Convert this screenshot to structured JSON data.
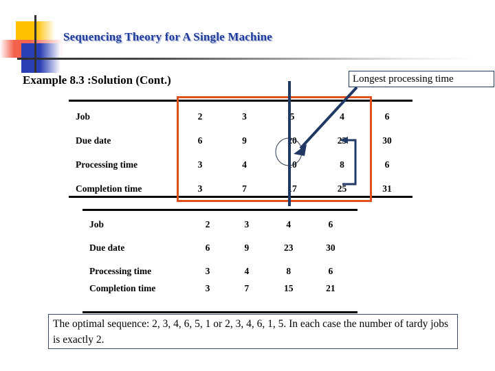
{
  "slide": {
    "title": "Sequencing Theory for A Single Machine",
    "subtitle": "Example 8.3 :Solution (Cont.)"
  },
  "callout": {
    "text": "Longest processing time"
  },
  "table1": {
    "rows": [
      {
        "label": "Job",
        "values": [
          "2",
          "3",
          "5",
          "4",
          "6"
        ]
      },
      {
        "label": "Due date",
        "values": [
          "6",
          "9",
          "20",
          "23",
          "30"
        ]
      },
      {
        "label": "Processing time",
        "values": [
          "3",
          "4",
          "10",
          "8",
          "6"
        ]
      },
      {
        "label": "Completion time",
        "values": [
          "3",
          "7",
          "17",
          "25",
          "31"
        ]
      }
    ]
  },
  "table2": {
    "rows": [
      {
        "label": "Job",
        "values": [
          "2",
          "3",
          "4",
          "6"
        ]
      },
      {
        "label": "Due date",
        "values": [
          "6",
          "9",
          "23",
          "30"
        ]
      },
      {
        "label": "Processing time",
        "values": [
          "3",
          "4",
          "8",
          "6"
        ]
      },
      {
        "label": "Completion time",
        "values": [
          "3",
          "7",
          "15",
          "21"
        ]
      }
    ]
  },
  "conclusion": {
    "text": "The optimal sequence: 2, 3, 4, 6, 5, 1 or 2, 3, 4, 6, 1, 5. In each case the number of tardy jobs is exactly 2."
  },
  "colors": {
    "title_blue": "#1F3B9B",
    "highlight_orange": "#E04E1B",
    "annotation_blue": "#1F3864",
    "logo_yellow": "#FFC000",
    "logo_red": "#F4624E",
    "logo_blue": "#2B3FB5"
  }
}
